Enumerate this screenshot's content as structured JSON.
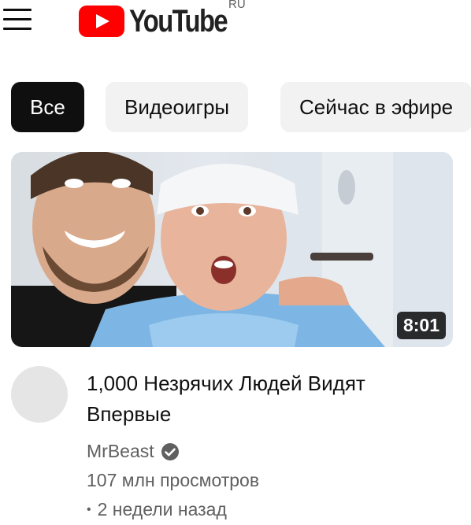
{
  "header": {
    "logo_text": "YouTube",
    "logo_region": "RU"
  },
  "chips": [
    "Все",
    "Видеоигры",
    "Сейчас в эфире"
  ],
  "video": {
    "duration": "8:01",
    "title": "1,000 Незрячих Людей Видят Впервые",
    "channel": "MrBeast",
    "views": "107 млн просмотров",
    "age_separator": "•",
    "age": "2 недели назад"
  },
  "colors": {
    "brand_red": "#ff0000",
    "chip_active_bg": "#0f0f0f",
    "chip_bg": "#f2f2f2",
    "secondary_text": "#606060"
  },
  "icons": [
    "menu-icon",
    "youtube-play-icon",
    "verified-icon"
  ]
}
